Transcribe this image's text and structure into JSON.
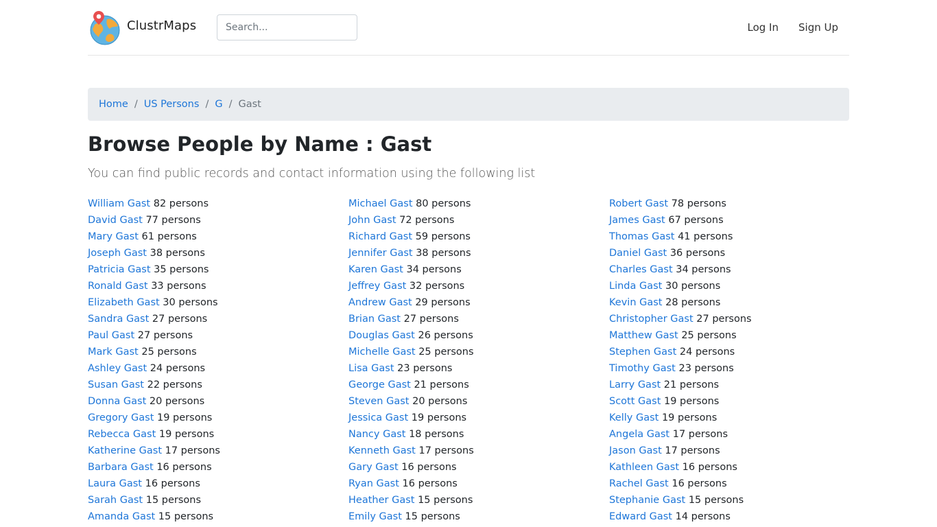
{
  "header": {
    "brand": "ClustrMaps",
    "search_placeholder": "Search...",
    "login": "Log In",
    "signup": "Sign Up"
  },
  "breadcrumb": {
    "home": "Home",
    "us_persons": "US Persons",
    "letter": "G",
    "current": "Gast"
  },
  "page": {
    "title": "Browse People by Name : Gast",
    "lead": "You can find public records and contact information using the following list"
  },
  "people": [
    {
      "name": "William Gast",
      "count": "82 persons"
    },
    {
      "name": "Michael Gast",
      "count": "80 persons"
    },
    {
      "name": "Robert Gast",
      "count": "78 persons"
    },
    {
      "name": "David Gast",
      "count": "77 persons"
    },
    {
      "name": "John Gast",
      "count": "72 persons"
    },
    {
      "name": "James Gast",
      "count": "67 persons"
    },
    {
      "name": "Mary Gast",
      "count": "61 persons"
    },
    {
      "name": "Richard Gast",
      "count": "59 persons"
    },
    {
      "name": "Thomas Gast",
      "count": "41 persons"
    },
    {
      "name": "Joseph Gast",
      "count": "38 persons"
    },
    {
      "name": "Jennifer Gast",
      "count": "38 persons"
    },
    {
      "name": "Daniel Gast",
      "count": "36 persons"
    },
    {
      "name": "Patricia Gast",
      "count": "35 persons"
    },
    {
      "name": "Karen Gast",
      "count": "34 persons"
    },
    {
      "name": "Charles Gast",
      "count": "34 persons"
    },
    {
      "name": "Ronald Gast",
      "count": "33 persons"
    },
    {
      "name": "Jeffrey Gast",
      "count": "32 persons"
    },
    {
      "name": "Linda Gast",
      "count": "30 persons"
    },
    {
      "name": "Elizabeth Gast",
      "count": "30 persons"
    },
    {
      "name": "Andrew Gast",
      "count": "29 persons"
    },
    {
      "name": "Kevin Gast",
      "count": "28 persons"
    },
    {
      "name": "Sandra Gast",
      "count": "27 persons"
    },
    {
      "name": "Brian Gast",
      "count": "27 persons"
    },
    {
      "name": "Christopher Gast",
      "count": "27 persons"
    },
    {
      "name": "Paul Gast",
      "count": "27 persons"
    },
    {
      "name": "Douglas Gast",
      "count": "26 persons"
    },
    {
      "name": "Matthew Gast",
      "count": "25 persons"
    },
    {
      "name": "Mark Gast",
      "count": "25 persons"
    },
    {
      "name": "Michelle Gast",
      "count": "25 persons"
    },
    {
      "name": "Stephen Gast",
      "count": "24 persons"
    },
    {
      "name": "Ashley Gast",
      "count": "24 persons"
    },
    {
      "name": "Lisa Gast",
      "count": "23 persons"
    },
    {
      "name": "Timothy Gast",
      "count": "23 persons"
    },
    {
      "name": "Susan Gast",
      "count": "22 persons"
    },
    {
      "name": "George Gast",
      "count": "21 persons"
    },
    {
      "name": "Larry Gast",
      "count": "21 persons"
    },
    {
      "name": "Donna Gast",
      "count": "20 persons"
    },
    {
      "name": "Steven Gast",
      "count": "20 persons"
    },
    {
      "name": "Scott Gast",
      "count": "19 persons"
    },
    {
      "name": "Gregory Gast",
      "count": "19 persons"
    },
    {
      "name": "Jessica Gast",
      "count": "19 persons"
    },
    {
      "name": "Kelly Gast",
      "count": "19 persons"
    },
    {
      "name": "Rebecca Gast",
      "count": "19 persons"
    },
    {
      "name": "Nancy Gast",
      "count": "18 persons"
    },
    {
      "name": "Angela Gast",
      "count": "17 persons"
    },
    {
      "name": "Katherine Gast",
      "count": "17 persons"
    },
    {
      "name": "Kenneth Gast",
      "count": "17 persons"
    },
    {
      "name": "Jason Gast",
      "count": "17 persons"
    },
    {
      "name": "Barbara Gast",
      "count": "16 persons"
    },
    {
      "name": "Gary Gast",
      "count": "16 persons"
    },
    {
      "name": "Kathleen Gast",
      "count": "16 persons"
    },
    {
      "name": "Laura Gast",
      "count": "16 persons"
    },
    {
      "name": "Ryan Gast",
      "count": "16 persons"
    },
    {
      "name": "Rachel Gast",
      "count": "16 persons"
    },
    {
      "name": "Sarah Gast",
      "count": "15 persons"
    },
    {
      "name": "Heather Gast",
      "count": "15 persons"
    },
    {
      "name": "Stephanie Gast",
      "count": "15 persons"
    },
    {
      "name": "Amanda Gast",
      "count": "15 persons"
    },
    {
      "name": "Emily Gast",
      "count": "15 persons"
    },
    {
      "name": "Edward Gast",
      "count": "14 persons"
    }
  ]
}
